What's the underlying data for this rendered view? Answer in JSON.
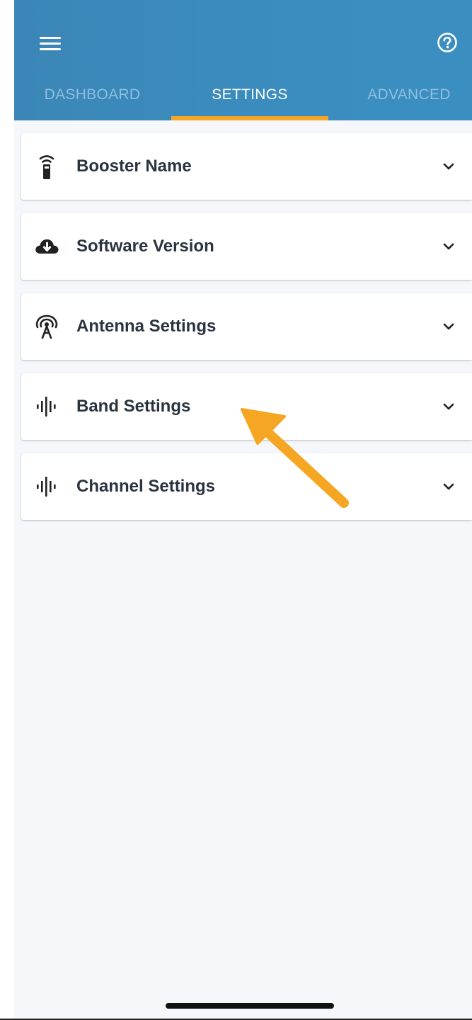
{
  "header": {
    "menu_icon": "hamburger-menu-icon",
    "help_icon": "help-circle-icon",
    "colors": {
      "bar": "#3b8ac0",
      "active_tab": "#ffffff",
      "inactive_tab": "#8fc0e0",
      "indicator": "#f5a623"
    }
  },
  "tabs": [
    {
      "label": "DASHBOARD",
      "active": false
    },
    {
      "label": "SETTINGS",
      "active": true
    },
    {
      "label": "ADVANCED",
      "active": false
    }
  ],
  "settings": [
    {
      "label": "Booster Name",
      "icon": "booster-device-icon"
    },
    {
      "label": "Software Version",
      "icon": "cloud-download-icon"
    },
    {
      "label": "Antenna Settings",
      "icon": "antenna-icon"
    },
    {
      "label": "Band Settings",
      "icon": "waveform-icon"
    },
    {
      "label": "Channel Settings",
      "icon": "waveform-icon"
    }
  ],
  "annotation": {
    "icon": "arrow-pointer-icon",
    "color": "#f5a623"
  }
}
